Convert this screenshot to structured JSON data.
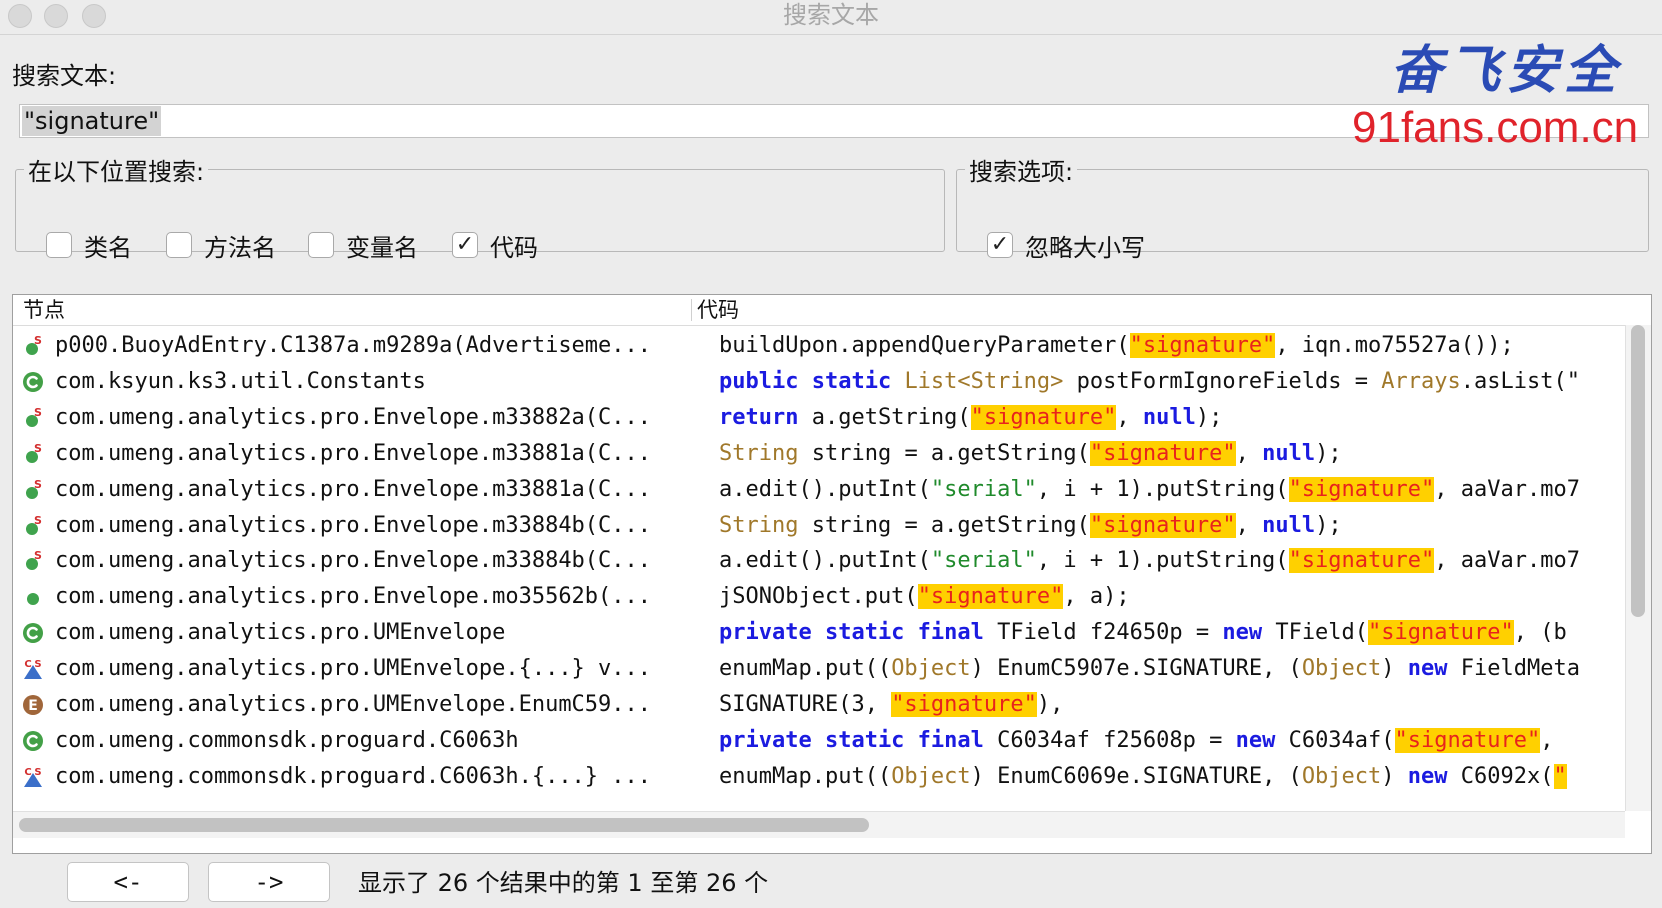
{
  "window": {
    "title": "搜索文本"
  },
  "search": {
    "label": "搜索文本:",
    "value": "\"signature\""
  },
  "watermark": {
    "brand": "奋飞安全",
    "url": "91fans.com.cn"
  },
  "location_group": {
    "legend": "在以下位置搜索:",
    "options": [
      {
        "label": "类名",
        "checked": false
      },
      {
        "label": "方法名",
        "checked": false
      },
      {
        "label": "变量名",
        "checked": false
      },
      {
        "label": "代码",
        "checked": true
      }
    ]
  },
  "options_group": {
    "legend": "搜索选项:",
    "options": [
      {
        "label": "忽略大小写",
        "checked": true
      }
    ]
  },
  "results": {
    "columns": [
      "节点",
      "代码"
    ],
    "rows": [
      {
        "icon": "static-method-icon",
        "node": "p000.BuoyAdEntry.C1387a.m9289a(Advertiseme...",
        "code": [
          [
            "n",
            "buildUpon.appendQueryParameter("
          ],
          [
            "h",
            "\"signature\""
          ],
          [
            "n",
            ", iqn.mo75527a());"
          ]
        ]
      },
      {
        "icon": "class-icon",
        "node": "com.ksyun.ks3.util.Constants",
        "code": [
          [
            "k",
            "public static "
          ],
          [
            "t",
            "List<String>"
          ],
          [
            "n",
            " postFormIgnoreFields = "
          ],
          [
            "t",
            "Arrays"
          ],
          [
            "n",
            ".asList(\""
          ]
        ]
      },
      {
        "icon": "static-method-icon",
        "node": "com.umeng.analytics.pro.Envelope.m33882a(C...",
        "code": [
          [
            "k",
            "return"
          ],
          [
            "n",
            " a.getString("
          ],
          [
            "h",
            "\"signature\""
          ],
          [
            "n",
            ", "
          ],
          [
            "k",
            "null"
          ],
          [
            "n",
            ");"
          ]
        ]
      },
      {
        "icon": "static-method-icon",
        "node": "com.umeng.analytics.pro.Envelope.m33881a(C...",
        "code": [
          [
            "t",
            "String"
          ],
          [
            "n",
            " string = a.getString("
          ],
          [
            "h",
            "\"signature\""
          ],
          [
            "n",
            ", "
          ],
          [
            "k",
            "null"
          ],
          [
            "n",
            ");"
          ]
        ]
      },
      {
        "icon": "static-method-icon",
        "node": "com.umeng.analytics.pro.Envelope.m33881a(C...",
        "code": [
          [
            "n",
            "a.edit().putInt("
          ],
          [
            "s",
            "\"serial\""
          ],
          [
            "n",
            ", i + 1).putString("
          ],
          [
            "h",
            "\"signature\""
          ],
          [
            "n",
            ", aaVar.mo7"
          ]
        ]
      },
      {
        "icon": "static-method-icon",
        "node": "com.umeng.analytics.pro.Envelope.m33884b(C...",
        "code": [
          [
            "t",
            "String"
          ],
          [
            "n",
            " string = a.getString("
          ],
          [
            "h",
            "\"signature\""
          ],
          [
            "n",
            ", "
          ],
          [
            "k",
            "null"
          ],
          [
            "n",
            ");"
          ]
        ]
      },
      {
        "icon": "static-method-icon",
        "node": "com.umeng.analytics.pro.Envelope.m33884b(C...",
        "code": [
          [
            "n",
            "a.edit().putInt("
          ],
          [
            "s",
            "\"serial\""
          ],
          [
            "n",
            ", i + 1).putString("
          ],
          [
            "h",
            "\"signature\""
          ],
          [
            "n",
            ", aaVar.mo7"
          ]
        ]
      },
      {
        "icon": "method-icon",
        "node": "com.umeng.analytics.pro.Envelope.mo35562b(...",
        "code": [
          [
            "n",
            "jSONObject.put("
          ],
          [
            "h",
            "\"signature\""
          ],
          [
            "n",
            ", a);"
          ]
        ]
      },
      {
        "icon": "class-icon",
        "node": "com.umeng.analytics.pro.UMEnvelope",
        "code": [
          [
            "k",
            "private static final"
          ],
          [
            "n",
            " TField f24650p = "
          ],
          [
            "k",
            "new"
          ],
          [
            "n",
            " TField("
          ],
          [
            "h",
            "\"signature\""
          ],
          [
            "n",
            ", (b"
          ]
        ]
      },
      {
        "icon": "static-constructor-icon",
        "node": "com.umeng.analytics.pro.UMEnvelope.{...} v...",
        "code": [
          [
            "n",
            "enumMap.put(("
          ],
          [
            "t",
            "Object"
          ],
          [
            "n",
            ") EnumC5907e.SIGNATURE, ("
          ],
          [
            "t",
            "Object"
          ],
          [
            "n",
            ") "
          ],
          [
            "k",
            "new"
          ],
          [
            "n",
            " FieldMeta"
          ]
        ]
      },
      {
        "icon": "enum-icon",
        "node": "com.umeng.analytics.pro.UMEnvelope.EnumC59...",
        "code": [
          [
            "n",
            "SIGNATURE(3, "
          ],
          [
            "h",
            "\"signature\""
          ],
          [
            "n",
            "),"
          ]
        ]
      },
      {
        "icon": "class-icon",
        "node": "com.umeng.commonsdk.proguard.C6063h",
        "code": [
          [
            "k",
            "private static final"
          ],
          [
            "n",
            " C6034af f25608p = "
          ],
          [
            "k",
            "new"
          ],
          [
            "n",
            " C6034af("
          ],
          [
            "h",
            "\"signature\""
          ],
          [
            "n",
            ","
          ]
        ]
      },
      {
        "icon": "static-constructor-icon",
        "node": "com.umeng.commonsdk.proguard.C6063h.{...} ...",
        "code": [
          [
            "n",
            "enumMap.put(("
          ],
          [
            "t",
            "Object"
          ],
          [
            "n",
            ") EnumC6069e.SIGNATURE, ("
          ],
          [
            "t",
            "Object"
          ],
          [
            "n",
            ") "
          ],
          [
            "k",
            "new"
          ],
          [
            "n",
            " C6092x("
          ],
          [
            "h",
            "\""
          ]
        ]
      }
    ]
  },
  "nav": {
    "prev_label": "<-",
    "next_label": "->"
  },
  "status": {
    "text": "显示了 26 个结果中的第 1 至第 26 个"
  },
  "colors": {
    "keyword": "#1b1be0",
    "type": "#a0782a",
    "string": "#1f8a2b",
    "highlight_bg": "#ffd000",
    "highlight_fg": "#e8231c",
    "watermark_blue": "#2a4bb5",
    "watermark_red": "#e0232b"
  }
}
